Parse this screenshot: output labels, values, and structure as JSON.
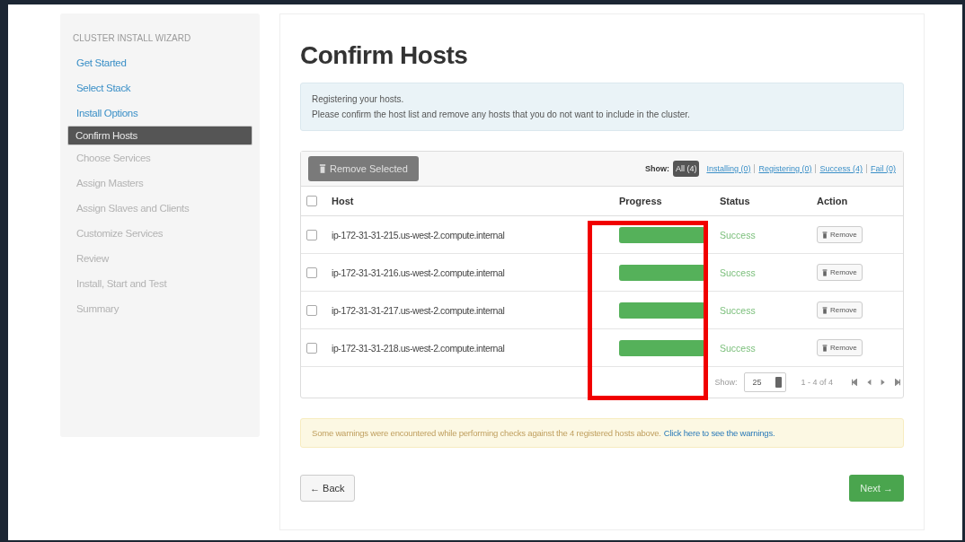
{
  "sidebar": {
    "heading": "CLUSTER INSTALL WIZARD",
    "items": [
      {
        "label": "Get Started",
        "selected": false,
        "disabled": false
      },
      {
        "label": "Select Stack",
        "selected": false,
        "disabled": false
      },
      {
        "label": "Install Options",
        "selected": false,
        "disabled": false
      },
      {
        "label": "Confirm Hosts",
        "selected": true,
        "disabled": false
      },
      {
        "label": "Choose Services",
        "selected": false,
        "disabled": true
      },
      {
        "label": "Assign Masters",
        "selected": false,
        "disabled": true
      },
      {
        "label": "Assign Slaves and Clients",
        "selected": false,
        "disabled": true
      },
      {
        "label": "Customize Services",
        "selected": false,
        "disabled": true
      },
      {
        "label": "Review",
        "selected": false,
        "disabled": true
      },
      {
        "label": "Install, Start and Test",
        "selected": false,
        "disabled": true
      },
      {
        "label": "Summary",
        "selected": false,
        "disabled": true
      }
    ]
  },
  "title": "Confirm Hosts",
  "info": [
    "Registering your hosts.",
    "Please confirm the host list and remove any hosts that you do not want to include in the cluster."
  ],
  "toolbar": {
    "remove_selected": "Remove Selected",
    "show_label": "Show:",
    "filters": [
      {
        "label": "All (4)",
        "selected": true
      },
      {
        "label": "Installing (0)",
        "selected": false
      },
      {
        "label": "Registering (0)",
        "selected": false
      },
      {
        "label": "Success (4)",
        "selected": false
      },
      {
        "label": "Fail (0)",
        "selected": false
      }
    ]
  },
  "table": {
    "select_all": {
      "checked": false
    },
    "columns": [
      "Host",
      "Progress",
      "Status",
      "Action"
    ],
    "rows": [
      {
        "checked": false,
        "host": "ip-172-31-31-215.us-west-2.compute.internal",
        "level": 1,
        "status": "Success",
        "action": "Remove"
      },
      {
        "checked": false,
        "host": "ip-172-31-31-216.us-west-2.compute.internal",
        "level": 1,
        "status": "Success",
        "action": "Remove"
      },
      {
        "checked": false,
        "host": "ip-172-31-31-217.us-west-2.compute.internal",
        "level": 1,
        "status": "Success",
        "action": "Remove"
      },
      {
        "checked": false,
        "host": "ip-172-31-31-218.us-west-2.compute.internal",
        "level": 1,
        "status": "Success",
        "action": "Remove"
      }
    ],
    "footer": {
      "show_label": "Show:",
      "page_size": "25",
      "range": "1 - 4 of 4"
    }
  },
  "warning": {
    "text": "Some warnings were encountered while performing checks against the 4 registered hosts above.",
    "link": "Click here to see the warnings."
  },
  "buttons": {
    "back": "← Back",
    "next": "Next →"
  }
}
